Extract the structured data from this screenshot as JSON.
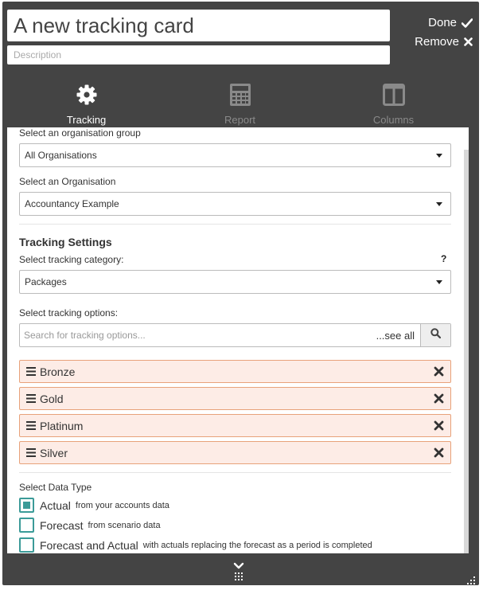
{
  "header": {
    "title": "A new tracking card",
    "description_placeholder": "Description",
    "done_label": "Done",
    "remove_label": "Remove"
  },
  "tabs": [
    {
      "label": "Tracking",
      "icon": "gear-icon",
      "active": true
    },
    {
      "label": "Report",
      "icon": "calculator-icon",
      "active": false
    },
    {
      "label": "Columns",
      "icon": "columns-icon",
      "active": false
    }
  ],
  "form": {
    "org_group_label": "Select an organisation group",
    "org_group_value": "All Organisations",
    "org_label": "Select an Organisation",
    "org_value": "Accountancy Example",
    "tracking_settings_title": "Tracking Settings",
    "tracking_category_label": "Select tracking category:",
    "help_label": "?",
    "tracking_category_value": "Packages",
    "tracking_options_label": "Select tracking options:",
    "search_placeholder": "Search for tracking options...",
    "see_all_label": "...see all",
    "options": [
      "Bronze",
      "Gold",
      "Platinum",
      "Silver"
    ],
    "data_type_label": "Select Data Type",
    "data_types": [
      {
        "label": "Actual",
        "sub": "from your accounts data",
        "checked": true
      },
      {
        "label": "Forecast",
        "sub": "from scenario data",
        "checked": false
      },
      {
        "label": "Forecast and Actual",
        "sub": "with actuals replacing the forecast as a period is completed",
        "checked": false
      }
    ]
  },
  "colors": {
    "card_bg": "#444444",
    "accent_teal": "#3b9b98",
    "option_bg": "#fdece6",
    "option_border": "#e8a27a"
  }
}
